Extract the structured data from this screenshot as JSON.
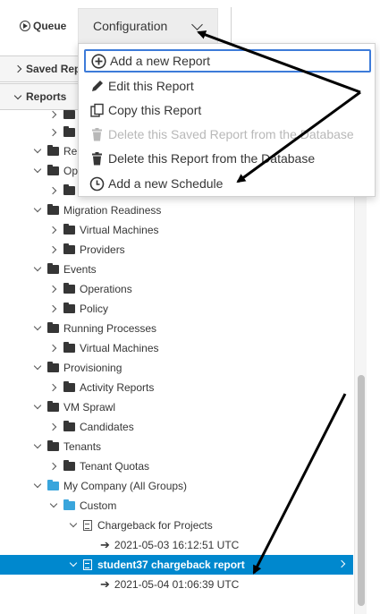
{
  "toolbar": {
    "queue_label": "Queue",
    "configuration_label": "Configuration"
  },
  "accordions": {
    "saved_reports": "Saved Rep",
    "reports": "Reports"
  },
  "config_menu": {
    "items": [
      {
        "label": "Add a new Report",
        "icon": "plus-circle-icon",
        "state": "focused"
      },
      {
        "label": "Edit this Report",
        "icon": "pencil-icon",
        "state": "enabled"
      },
      {
        "label": "Copy this Report",
        "icon": "copy-icon",
        "state": "enabled"
      },
      {
        "label": "Delete this Saved Report from the Database",
        "icon": "trash-icon",
        "state": "disabled"
      },
      {
        "label": "Delete this Report from the Database",
        "icon": "trash-icon",
        "state": "enabled"
      },
      {
        "label": "Add a new Schedule",
        "icon": "clock-icon",
        "state": "enabled"
      }
    ]
  },
  "tree": {
    "rows": [
      {
        "label": "Rela",
        "depth": 0,
        "toggle": "down",
        "icon": "folder"
      },
      {
        "label": "Ope",
        "depth": 0,
        "toggle": "down",
        "icon": "folder"
      },
      {
        "label": "Virtual Machines",
        "depth": 1,
        "toggle": "right",
        "icon": "folder"
      },
      {
        "label": "Migration Readiness",
        "depth": 0,
        "toggle": "down",
        "icon": "folder"
      },
      {
        "label": "Virtual Machines",
        "depth": 1,
        "toggle": "right",
        "icon": "folder"
      },
      {
        "label": "Providers",
        "depth": 1,
        "toggle": "right",
        "icon": "folder"
      },
      {
        "label": "Events",
        "depth": 0,
        "toggle": "down",
        "icon": "folder"
      },
      {
        "label": "Operations",
        "depth": 1,
        "toggle": "right",
        "icon": "folder"
      },
      {
        "label": "Policy",
        "depth": 1,
        "toggle": "right",
        "icon": "folder"
      },
      {
        "label": "Running Processes",
        "depth": 0,
        "toggle": "down",
        "icon": "folder"
      },
      {
        "label": "Virtual Machines",
        "depth": 1,
        "toggle": "right",
        "icon": "folder"
      },
      {
        "label": "Provisioning",
        "depth": 0,
        "toggle": "down",
        "icon": "folder"
      },
      {
        "label": "Activity Reports",
        "depth": 1,
        "toggle": "right",
        "icon": "folder"
      },
      {
        "label": "VM Sprawl",
        "depth": 0,
        "toggle": "down",
        "icon": "folder"
      },
      {
        "label": "Candidates",
        "depth": 1,
        "toggle": "right",
        "icon": "folder"
      },
      {
        "label": "Tenants",
        "depth": 0,
        "toggle": "down",
        "icon": "folder"
      },
      {
        "label": "Tenant Quotas",
        "depth": 1,
        "toggle": "right",
        "icon": "folder"
      },
      {
        "label": "My Company (All Groups)",
        "depth": 0,
        "toggle": "down",
        "icon": "folder-blue"
      },
      {
        "label": "Custom",
        "depth": 1,
        "toggle": "down",
        "icon": "folder-blue"
      },
      {
        "label": "Chargeback for Projects",
        "depth": 2,
        "toggle": "down",
        "icon": "doc"
      },
      {
        "label": "2021-05-03 16:12:51 UTC",
        "depth": 3,
        "toggle": "none",
        "icon": "arrow"
      },
      {
        "label": "student37 chargeback report",
        "depth": 2,
        "toggle": "down",
        "icon": "doc",
        "selected": true
      },
      {
        "label": "2021-05-04 01:06:39 UTC",
        "depth": 3,
        "toggle": "none",
        "icon": "arrow"
      }
    ]
  },
  "colors": {
    "selection": "#0088ce",
    "custom_folder": "#39a5dc",
    "menu_focus": "#3d7bd9"
  }
}
